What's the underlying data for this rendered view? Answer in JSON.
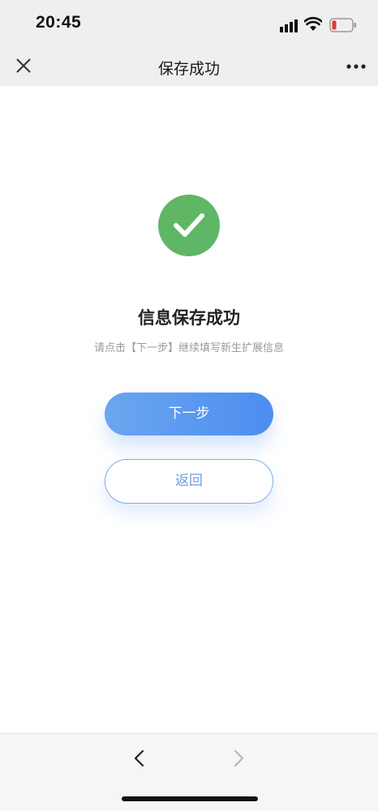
{
  "status_bar": {
    "time": "20:45",
    "icons": [
      "signal-icon",
      "wifi-icon",
      "battery-low-icon"
    ],
    "battery_color": "#e53935"
  },
  "nav_bar": {
    "title": "保存成功",
    "left_icon": "close-icon",
    "right_icon": "more-icon"
  },
  "content": {
    "status_icon": "check-circle-icon",
    "status_color": "#5fb665",
    "title": "信息保存成功",
    "subtitle": "请点击【下一步】继续填写新生扩展信息",
    "next_button_label": "下一步",
    "back_button_label": "返回",
    "accent_color": "#4d8df0"
  },
  "bottom_bar": {
    "icons": [
      "back-arrow-icon",
      "forward-arrow-icon"
    ]
  }
}
